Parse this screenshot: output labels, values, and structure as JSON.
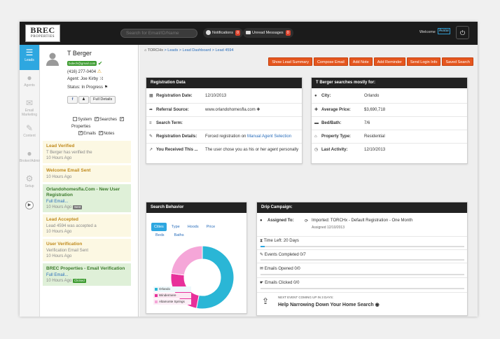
{
  "topbar": {
    "logo_main": "BREC",
    "logo_sub": "PROPERTIES",
    "search_placeholder": "Search for Email/ID/Name",
    "notifications_label": "Notifications",
    "notifications_count": "0",
    "messages_label": "Unread Messages",
    "messages_count": "0",
    "welcome": "Welcome",
    "avatar_text": "Avatar",
    "power_icon": "power-icon"
  },
  "rail": [
    {
      "label": "Leads",
      "icon": "list-icon",
      "glyph": "☰"
    },
    {
      "label": "Agents",
      "icon": "person-icon",
      "glyph": "●"
    },
    {
      "label": "Email Marketing",
      "icon": "envelope-icon",
      "glyph": "✉"
    },
    {
      "label": "Content",
      "icon": "pencil-icon",
      "glyph": "✎"
    },
    {
      "label": "Broker/Admin",
      "icon": "users-icon",
      "glyph": "●"
    },
    {
      "label": "Setup",
      "icon": "gear-icon",
      "glyph": "⚙"
    }
  ],
  "profile": {
    "name": "T Berger",
    "email_badge": "bolech@gmail.com",
    "phone": "(416) 277-0404",
    "agent": "Agent: Joe Kirby",
    "status": "Status: In Progress",
    "full_details": "Full Details"
  },
  "filters": {
    "system": "System",
    "searches": "Searches",
    "properties": "Properties",
    "emails": "Emails",
    "notes": "Notes"
  },
  "feed": [
    {
      "title": "Lead Verified",
      "lines": [
        "T Berger has verified the"
      ],
      "time": "10 Hours Ago",
      "tone": "y",
      "tag": ""
    },
    {
      "title": "Welcome Email Sent",
      "lines": [],
      "time": "10 Hours Ago",
      "tone": "y",
      "tag": ""
    },
    {
      "title": "Orlandohomesfla.Com - New User Registration",
      "lines": [
        "Full Email..."
      ],
      "time": "10 Hours Ago",
      "tone": "g",
      "tag": "Sent"
    },
    {
      "title": "Lead Accepted",
      "lines": [
        "Lead 4594 was accepted a"
      ],
      "time": "10 Hours Ago",
      "tone": "y",
      "tag": ""
    },
    {
      "title": "User Verification",
      "lines": [
        "Verification Email Sent"
      ],
      "time": "10 Hours Ago",
      "tone": "y",
      "tag": ""
    },
    {
      "title": "BREC Properties - Email Verification",
      "lines": [
        "Full Email..."
      ],
      "time": "10 Hours Ago",
      "tone": "g",
      "tag": "Clicked"
    }
  ],
  "breadcrumb": [
    "TORCHx",
    "Leads",
    "Lead Dashboard",
    "Lead 4594"
  ],
  "actions": [
    "Show Lead Summary",
    "Compose Email",
    "Add Note",
    "Add Reminder",
    "Send Login Info",
    "Saved Search"
  ],
  "registration": {
    "title": "Registration Data",
    "rows": [
      {
        "label": "Registration Date:",
        "value": "12/10/2013",
        "icon": "calendar-icon",
        "glyph": "▦"
      },
      {
        "label": "Referral Source:",
        "value": "www.orlandohomesfla.com",
        "icon": "share-icon",
        "glyph": "➦"
      },
      {
        "label": "Search Term:",
        "value": "",
        "icon": "lines-icon",
        "glyph": "≡"
      },
      {
        "label": "Registration Details:",
        "value": "Forced registration on ",
        "link": "Manual Agent Selection",
        "icon": "pencil-icon",
        "glyph": "✎"
      },
      {
        "label": "You Received This ...",
        "value": "The user chose you as his or her agent personally",
        "icon": "pin-icon",
        "glyph": "↗"
      }
    ]
  },
  "mostly": {
    "title": "T Berger searches mostly for:",
    "rows": [
      {
        "label": "City:",
        "value": "Orlando",
        "icon": "pin-icon",
        "glyph": "●"
      },
      {
        "label": "Average Price:",
        "value": "$3,690,718",
        "icon": "tag-icon",
        "glyph": "✚"
      },
      {
        "label": "Bed/Bath:",
        "value": "7/6",
        "icon": "bed-icon",
        "glyph": "▬"
      },
      {
        "label": "Property Type:",
        "value": "Residential",
        "icon": "house-icon",
        "glyph": "⌂"
      },
      {
        "label": "Last Activity:",
        "value": "12/10/2013",
        "icon": "clock-icon",
        "glyph": "◷"
      }
    ]
  },
  "behavior": {
    "title": "Search Behavior",
    "tabs": [
      "Cities",
      "Type",
      "Hoods",
      "Price"
    ],
    "subtabs": [
      "Beds",
      "Baths"
    ],
    "legend": [
      {
        "name": "Orlando",
        "color": "#2ab6d6"
      },
      {
        "name": "Windermere",
        "color": "#e8309a"
      },
      {
        "name": "Altamonte Springs",
        "color": "#f5a6d8"
      }
    ]
  },
  "chart_data": {
    "type": "pie",
    "categories": [
      "Orlando",
      "Windermere",
      "Altamonte Springs"
    ],
    "values": [
      53,
      24,
      23
    ],
    "colors": [
      "#2ab6d6",
      "#e8309a",
      "#f5a6d8"
    ]
  },
  "drip": {
    "title": "Drip Campaign:",
    "assigned_label": "Assigned To:",
    "assigned_value": "Imported: TORCHx - Default Registration - One Month",
    "assigned_date": "Assigned 12/10/2013",
    "time_left": "Time Left: 20 Days",
    "events": "Events Completed 0/7",
    "opened": "Emails Opened 0/0",
    "clicked": "Emails Clicked 0/0",
    "next_event": "NEXT EVENT COMING UP IN 3 DAYS:",
    "next_title": "Help Narrowing Down Your Home Search",
    "progress": {
      "time_left": 0.02,
      "events": 0,
      "opened": 0,
      "clicked": 0
    }
  }
}
